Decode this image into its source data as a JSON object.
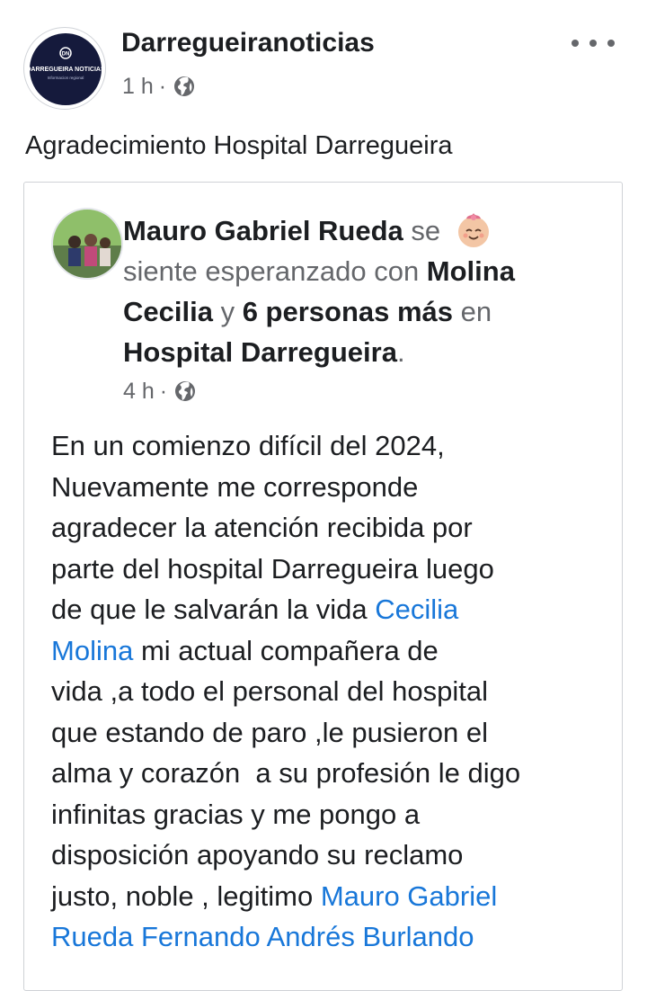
{
  "page": {
    "name": "Darregueiranoticias",
    "avatar_text": "DARREGUEIRA NOTICIAS",
    "avatar_subtext": "Informacion regional",
    "time": "1 h",
    "separator": "·",
    "post_text": "Agradecimiento Hospital Darregueira"
  },
  "shared_post": {
    "author": "Mauro Gabriel Rueda",
    "se": " se ",
    "feeling": "siente esperanzado con ",
    "tagged_1": "Molina Cecilia",
    "y": " y ",
    "tagged_others": "6 personas más",
    "en": " en ",
    "place": "Hospital Darregueira",
    "period": ".",
    "time": "4 h",
    "separator": "·",
    "body": {
      "l1": "En un comienzo difícil del 2024,",
      "l2": "Nuevamente me corresponde",
      "l3": "agradecer la atención recibida por",
      "l4": "parte del hospital Darregueira luego",
      "l5a": "de que le salvarán la vida ",
      "mention_1a": "Cecilia",
      "mention_1b": "Molina",
      "l6b": " mi actual compañera de",
      "l7": "vida ,a todo el personal del hospital",
      "l8": "que estando de paro ,le pusieron el",
      "l9": "alma y corazón  a su profesión le digo",
      "l10": "infinitas gracias y me pongo a",
      "l11": "disposición apoyando su reclamo",
      "l12a": "justo, noble , legitimo ",
      "mention_2a": "Mauro Gabriel",
      "mention_2b": "Rueda",
      "l13sp": " ",
      "mention_3": "Fernando Andrés Burlando"
    }
  },
  "colors": {
    "link": "#1877d9",
    "text": "#1c1e21",
    "meta": "#65676b",
    "border": "#cfd2d6"
  },
  "icons": {
    "globe": "globe-icon",
    "more": "more-options-icon",
    "feeling": "smiling-baby-emoji"
  }
}
